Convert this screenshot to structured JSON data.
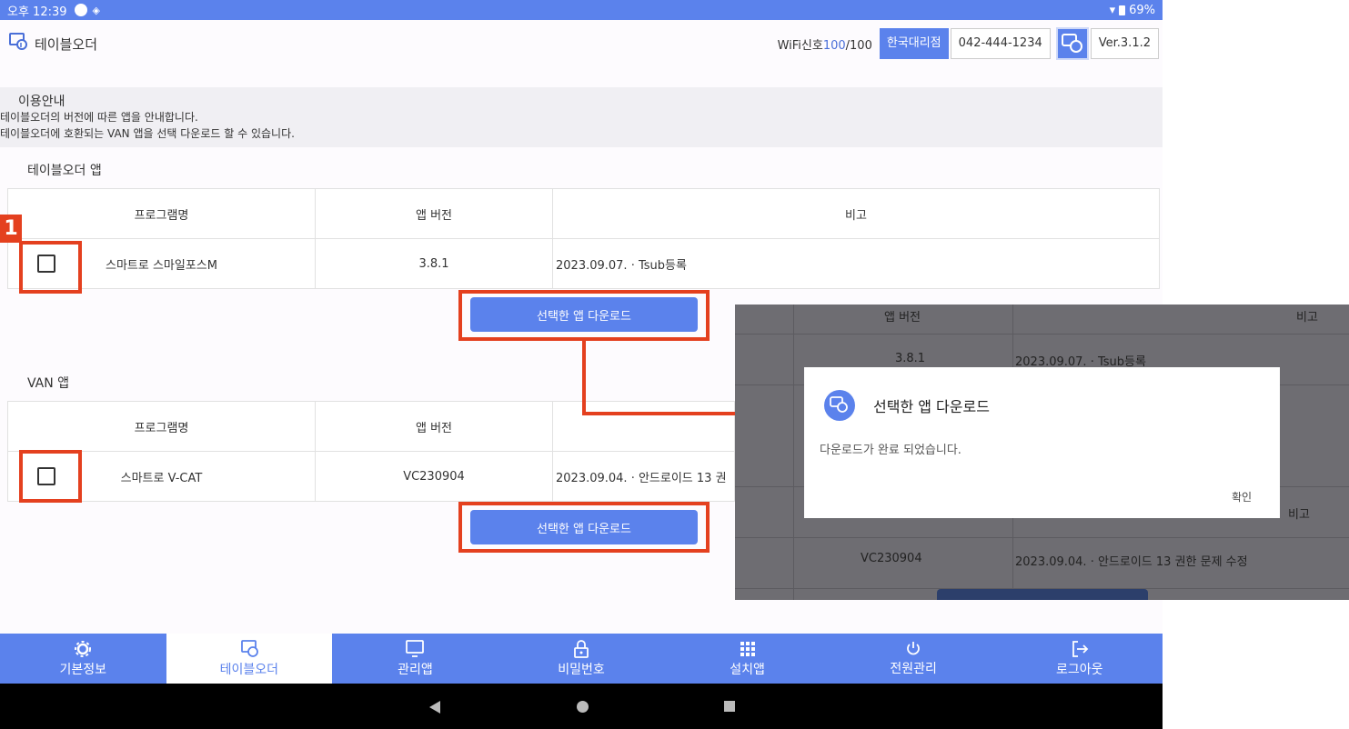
{
  "status": {
    "time": "오후 12:39",
    "battery": "69%"
  },
  "header": {
    "title": "테이블오더",
    "wifi_label": "WiFi신호",
    "wifi_value": "100",
    "wifi_max": "/100",
    "agency": "한국대리점",
    "phone": "042-444-1234",
    "version": "Ver.3.1.2"
  },
  "notice": {
    "heading": "이용안내",
    "lines": [
      "테이블오더의 버전에 따른 앱을 안내합니다.",
      "테이블오더에 호환되는 VAN 앱을 선택 다운로드 할 수 있습니다."
    ]
  },
  "sections": [
    {
      "title": "테이블오더 앱",
      "columns": [
        "프로그램명",
        "앱 버전",
        "비고"
      ],
      "rows": [
        {
          "name": "스마트로 스마일포스M",
          "version": "3.8.1",
          "note": "2023.09.07. · Tsub등록"
        }
      ],
      "button": "선택한 앱 다운로드"
    },
    {
      "title": "VAN 앱",
      "columns": [
        "프로그램명",
        "앱 버전",
        "비고"
      ],
      "rows": [
        {
          "name": "스마트로 V-CAT",
          "version": "VC230904",
          "note": "2023.09.04. · 안드로이드 13 권"
        }
      ],
      "button": "선택한 앱 다운로드"
    }
  ],
  "marker": "1",
  "nav": [
    {
      "label": "기본정보",
      "icon": "gear-icon"
    },
    {
      "label": "테이블오더",
      "icon": "tablet-touch-icon"
    },
    {
      "label": "관리앱",
      "icon": "monitor-icon"
    },
    {
      "label": "비밀번호",
      "icon": "lock-icon"
    },
    {
      "label": "설치앱",
      "icon": "grid-icon"
    },
    {
      "label": "전원관리",
      "icon": "power-icon"
    },
    {
      "label": "로그아웃",
      "icon": "logout-icon"
    }
  ],
  "callout": {
    "bg_header_version": "앱 버전",
    "bg_header_note": "비고",
    "bg_row1_version": "3.8.1",
    "bg_row1_note": "2023.09.07. · Tsub등록",
    "bg_header2_note": "비고",
    "bg_row2_version": "VC230904",
    "bg_row2_note": "2023.09.04. · 안드로이드 13 권한 문제 수정",
    "dialog": {
      "title": "선택한 앱 다운로드",
      "message": "다운로드가 완료 되었습니다.",
      "ok": "확인"
    }
  },
  "colors": {
    "accent": "#5b82ec",
    "highlight": "#e4401f"
  }
}
